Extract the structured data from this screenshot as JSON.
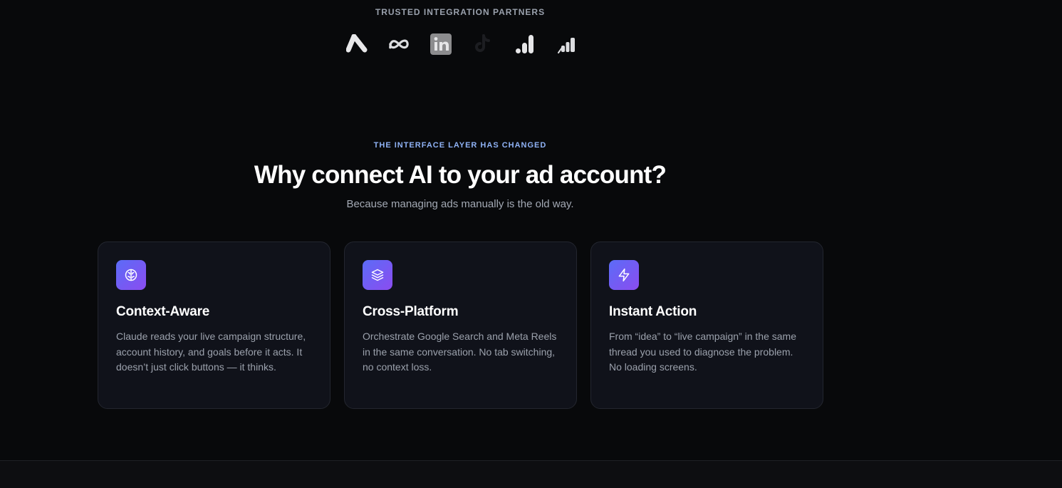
{
  "partners": {
    "label": "TRUSTED INTEGRATION PARTNERS",
    "logos": [
      "google-ads-logo",
      "meta-logo",
      "linkedin-logo",
      "tiktok-logo",
      "google-analytics-logo",
      "analytics-bars-logo"
    ]
  },
  "section": {
    "eyebrow": "THE INTERFACE LAYER HAS CHANGED",
    "headline": "Why connect AI to your ad account?",
    "subhead": "Because managing ads manually is the old way."
  },
  "cards": [
    {
      "icon": "brain-icon",
      "title": "Context-Aware",
      "description": "Claude reads your live campaign structure, account history, and goals before it acts. It doesn’t just click buttons — it thinks."
    },
    {
      "icon": "layers-icon",
      "title": "Cross-Platform",
      "description": "Orchestrate Google Search and Meta Reels in the same conversation. No tab switching, no context loss."
    },
    {
      "icon": "lightning-icon",
      "title": "Instant Action",
      "description": "From “idea” to “live campaign” in the same thread you used to diagnose the problem. No loading screens."
    }
  ],
  "colors": {
    "background": "#08090b",
    "card": "#10121a",
    "accent_gradient_start": "#5b6cf7",
    "accent_gradient_end": "#8b4cf0",
    "eyebrow": "#8fb2f5"
  }
}
